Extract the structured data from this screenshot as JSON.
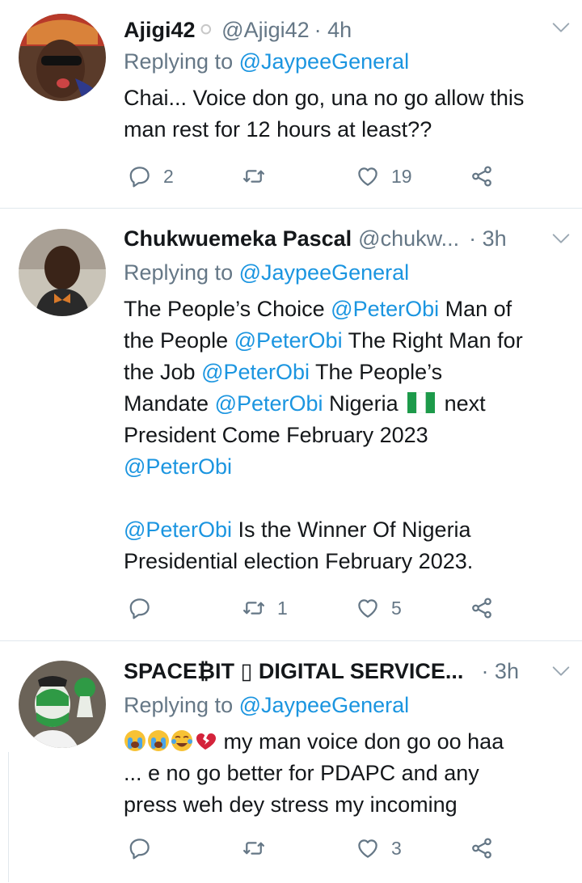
{
  "tweets": [
    {
      "name": "Ajigi42",
      "name_suffix": "⚪",
      "handle": "@Ajigi42",
      "time": "· 4h",
      "replying_prefix": "Replying to",
      "replying_to": "@JaypeeGeneral",
      "text_lines": [
        "Chai... Voice don go, una no go allow this",
        "man rest for 12 hours at least??"
      ],
      "replies": "2",
      "retweets": "",
      "likes": "19"
    },
    {
      "name": "Chukwuemeka Pascal",
      "handle": "@chukw...",
      "time": "· 3h",
      "replying_prefix": "Replying to",
      "replying_to": "@JaypeeGeneral",
      "body": {
        "l1a": "The People’s Choice ",
        "l1m": "@PeterObi",
        "l1b": " Man of",
        "l2a": "the People ",
        "l2m": "@PeterObi",
        "l2b": " The Right Man for",
        "l3a": "the Job ",
        "l3m": "@PeterObi",
        "l3b": " The People’s",
        "l4a": "Mandate ",
        "l4m": "@PeterObi",
        "l4b": " Nigeria ",
        "l4c": " next",
        "l5": "President Come February 2023",
        "l6m": "@PeterObi",
        "l8m": "@PeterObi",
        "l8b": " Is the Winner Of Nigeria",
        "l9": "Presidential election February 2023."
      },
      "replies": "",
      "retweets": "1",
      "likes": "5"
    },
    {
      "name": "SPACE₿IT ▯ DIGITAL SERVICE...",
      "time": "· 3h",
      "replying_prefix": "Replying to",
      "replying_to": "@JaypeeGeneral",
      "text_line1": " my man voice don go oo haa",
      "text_line2": "... e no go better for PDAPC and any",
      "text_line3": "press weh dey stress my incoming",
      "replies": "",
      "retweets": "",
      "likes": "3"
    }
  ],
  "colors": {
    "link": "#1b95e0",
    "muted": "#657786",
    "text": "#14171a",
    "divider": "#e1e8ed"
  },
  "icons": [
    "reply-icon",
    "retweet-icon",
    "like-icon",
    "share-icon",
    "chevron-down-icon"
  ]
}
